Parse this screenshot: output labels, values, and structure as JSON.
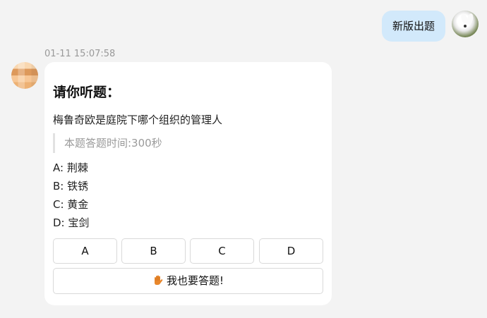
{
  "sent": {
    "text": "新版出题"
  },
  "received": {
    "timestamp": "01-11 15:07:58",
    "card": {
      "title": "请你听题：",
      "question": "梅鲁奇欧是庭院下哪个组织的管理人",
      "time_note": "本题答题时间:300秒",
      "options": [
        "A: 荆棘",
        "B: 铁锈",
        "C: 黄金",
        "D: 宝剑"
      ],
      "answer_buttons": [
        "A",
        "B",
        "C",
        "D"
      ],
      "join_button": "我也要答题!",
      "join_icon": "raised-hand-icon"
    }
  },
  "colors": {
    "page_bg": "#f3f3f3",
    "sent_bubble": "#d2e9fb",
    "card_bg": "#ffffff",
    "muted_text": "#9a9a9a",
    "button_border": "#d9d9d9",
    "hand_icon": "#e8872c"
  }
}
